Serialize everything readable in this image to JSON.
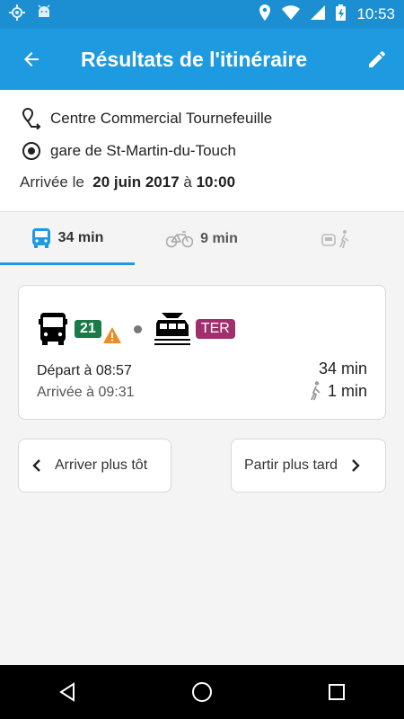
{
  "statusbar": {
    "time": "10:53"
  },
  "header": {
    "title": "Résultats de l'itinéraire"
  },
  "route": {
    "origin": "Centre Commercial Tournefeuille",
    "destination": "gare de St-Martin-du-Touch",
    "arrival_prefix": "Arrivée le",
    "arrival_date": "20 juin 2017",
    "arrival_at": "à",
    "arrival_time": "10:00"
  },
  "tabs": [
    {
      "label": "34 min",
      "icon": "bus-icon"
    },
    {
      "label": "9 min",
      "icon": "bicycle-icon"
    },
    {
      "label": "",
      "icon": "car-walk-icon"
    }
  ],
  "result": {
    "line_bus": "21",
    "line_train": "TER",
    "departure": "Départ à 08:57",
    "arrival": "Arrivée à 09:31",
    "duration": "34 min",
    "walk": "1 min"
  },
  "buttons": {
    "earlier": "Arriver plus tôt",
    "later": "Partir plus tard"
  },
  "colors": {
    "appbar": "#1e9ae0",
    "statusbar": "#1b8fd2",
    "line21": "#1a7a48",
    "ter": "#a0306c"
  }
}
